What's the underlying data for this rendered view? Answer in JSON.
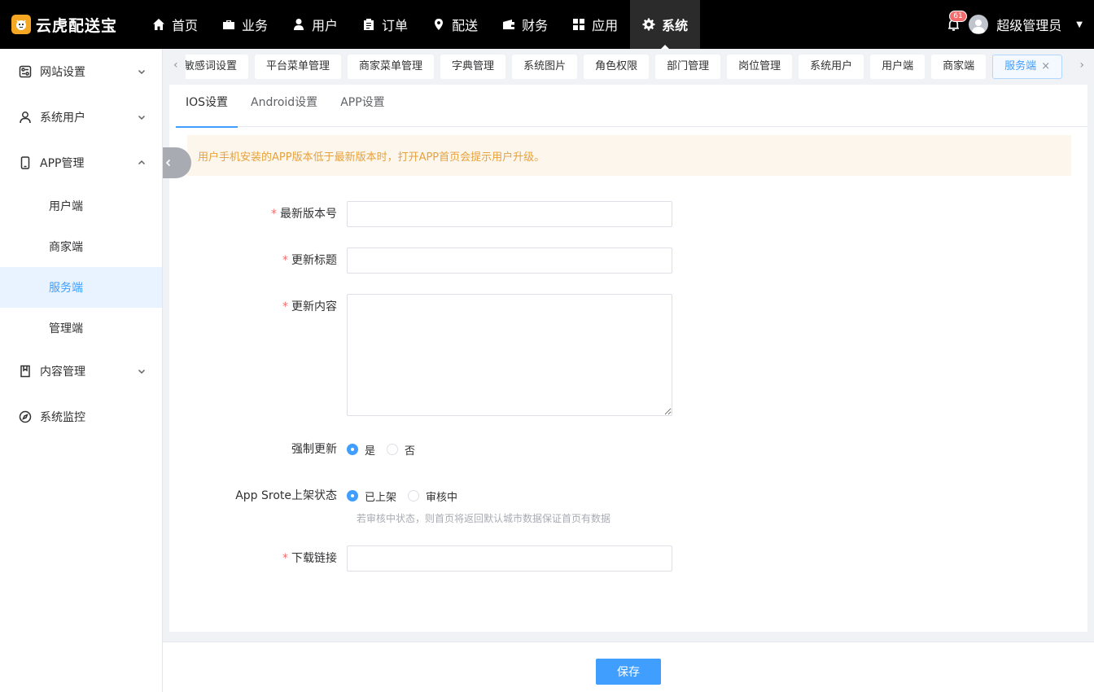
{
  "app": {
    "name": "云虎配送宝",
    "logo_icon": "tiger-logo-icon",
    "brand_color": "#f5a623"
  },
  "nav": {
    "items": [
      {
        "label": "首页",
        "icon": "home-icon"
      },
      {
        "label": "业务",
        "icon": "briefcase-icon"
      },
      {
        "label": "用户",
        "icon": "user-icon"
      },
      {
        "label": "订单",
        "icon": "clipboard-icon"
      },
      {
        "label": "配送",
        "icon": "location-icon"
      },
      {
        "label": "财务",
        "icon": "wallet-icon"
      },
      {
        "label": "应用",
        "icon": "grid-icon"
      },
      {
        "label": "系统",
        "icon": "gear-icon",
        "active": true
      }
    ],
    "notifications": "61",
    "username": "超级管理员"
  },
  "sidebar": {
    "items": [
      {
        "label": "网站设置",
        "icon": "settings-panel-icon",
        "expanded": false
      },
      {
        "label": "系统用户",
        "icon": "user-outline-icon",
        "expanded": false
      },
      {
        "label": "APP管理",
        "icon": "mobile-icon",
        "expanded": true,
        "children": [
          "用户端",
          "商家端",
          "服务端",
          "管理端"
        ],
        "active_child": "服务端"
      },
      {
        "label": "内容管理",
        "icon": "book-icon",
        "expanded": false
      },
      {
        "label": "系统监控",
        "icon": "compass-icon"
      }
    ]
  },
  "tabs": {
    "items": [
      "敏感词设置",
      "平台菜单管理",
      "商家菜单管理",
      "字典管理",
      "系统图片",
      "角色权限",
      "部门管理",
      "岗位管理",
      "系统用户",
      "用户端",
      "商家端",
      "服务端"
    ],
    "active": "服务端"
  },
  "subtabs": {
    "items": [
      "IOS设置",
      "Android设置",
      "APP设置"
    ],
    "active": "IOS设置"
  },
  "alert": {
    "text": "用户手机安装的APP版本低于最新版本时，打开APP首页会提示用户升级。"
  },
  "form": {
    "version_label": "最新版本号",
    "version_value": "",
    "title_label": "更新标题",
    "title_value": "",
    "content_label": "更新内容",
    "content_value": "",
    "force_label": "强制更新",
    "force_options": [
      "是",
      "否"
    ],
    "force_selected": "是",
    "store_label": "App Srote上架状态",
    "store_options": [
      "已上架",
      "审核中"
    ],
    "store_selected": "已上架",
    "store_hint": "若审核中状态，则首页将返回默认城市数据保证首页有数据",
    "link_label": "下载链接",
    "link_value": ""
  },
  "footer": {
    "save_label": "保存"
  },
  "colors": {
    "primary": "#409eff",
    "warning_bg": "#fdf6ec",
    "warning_text": "#e6a23c"
  }
}
